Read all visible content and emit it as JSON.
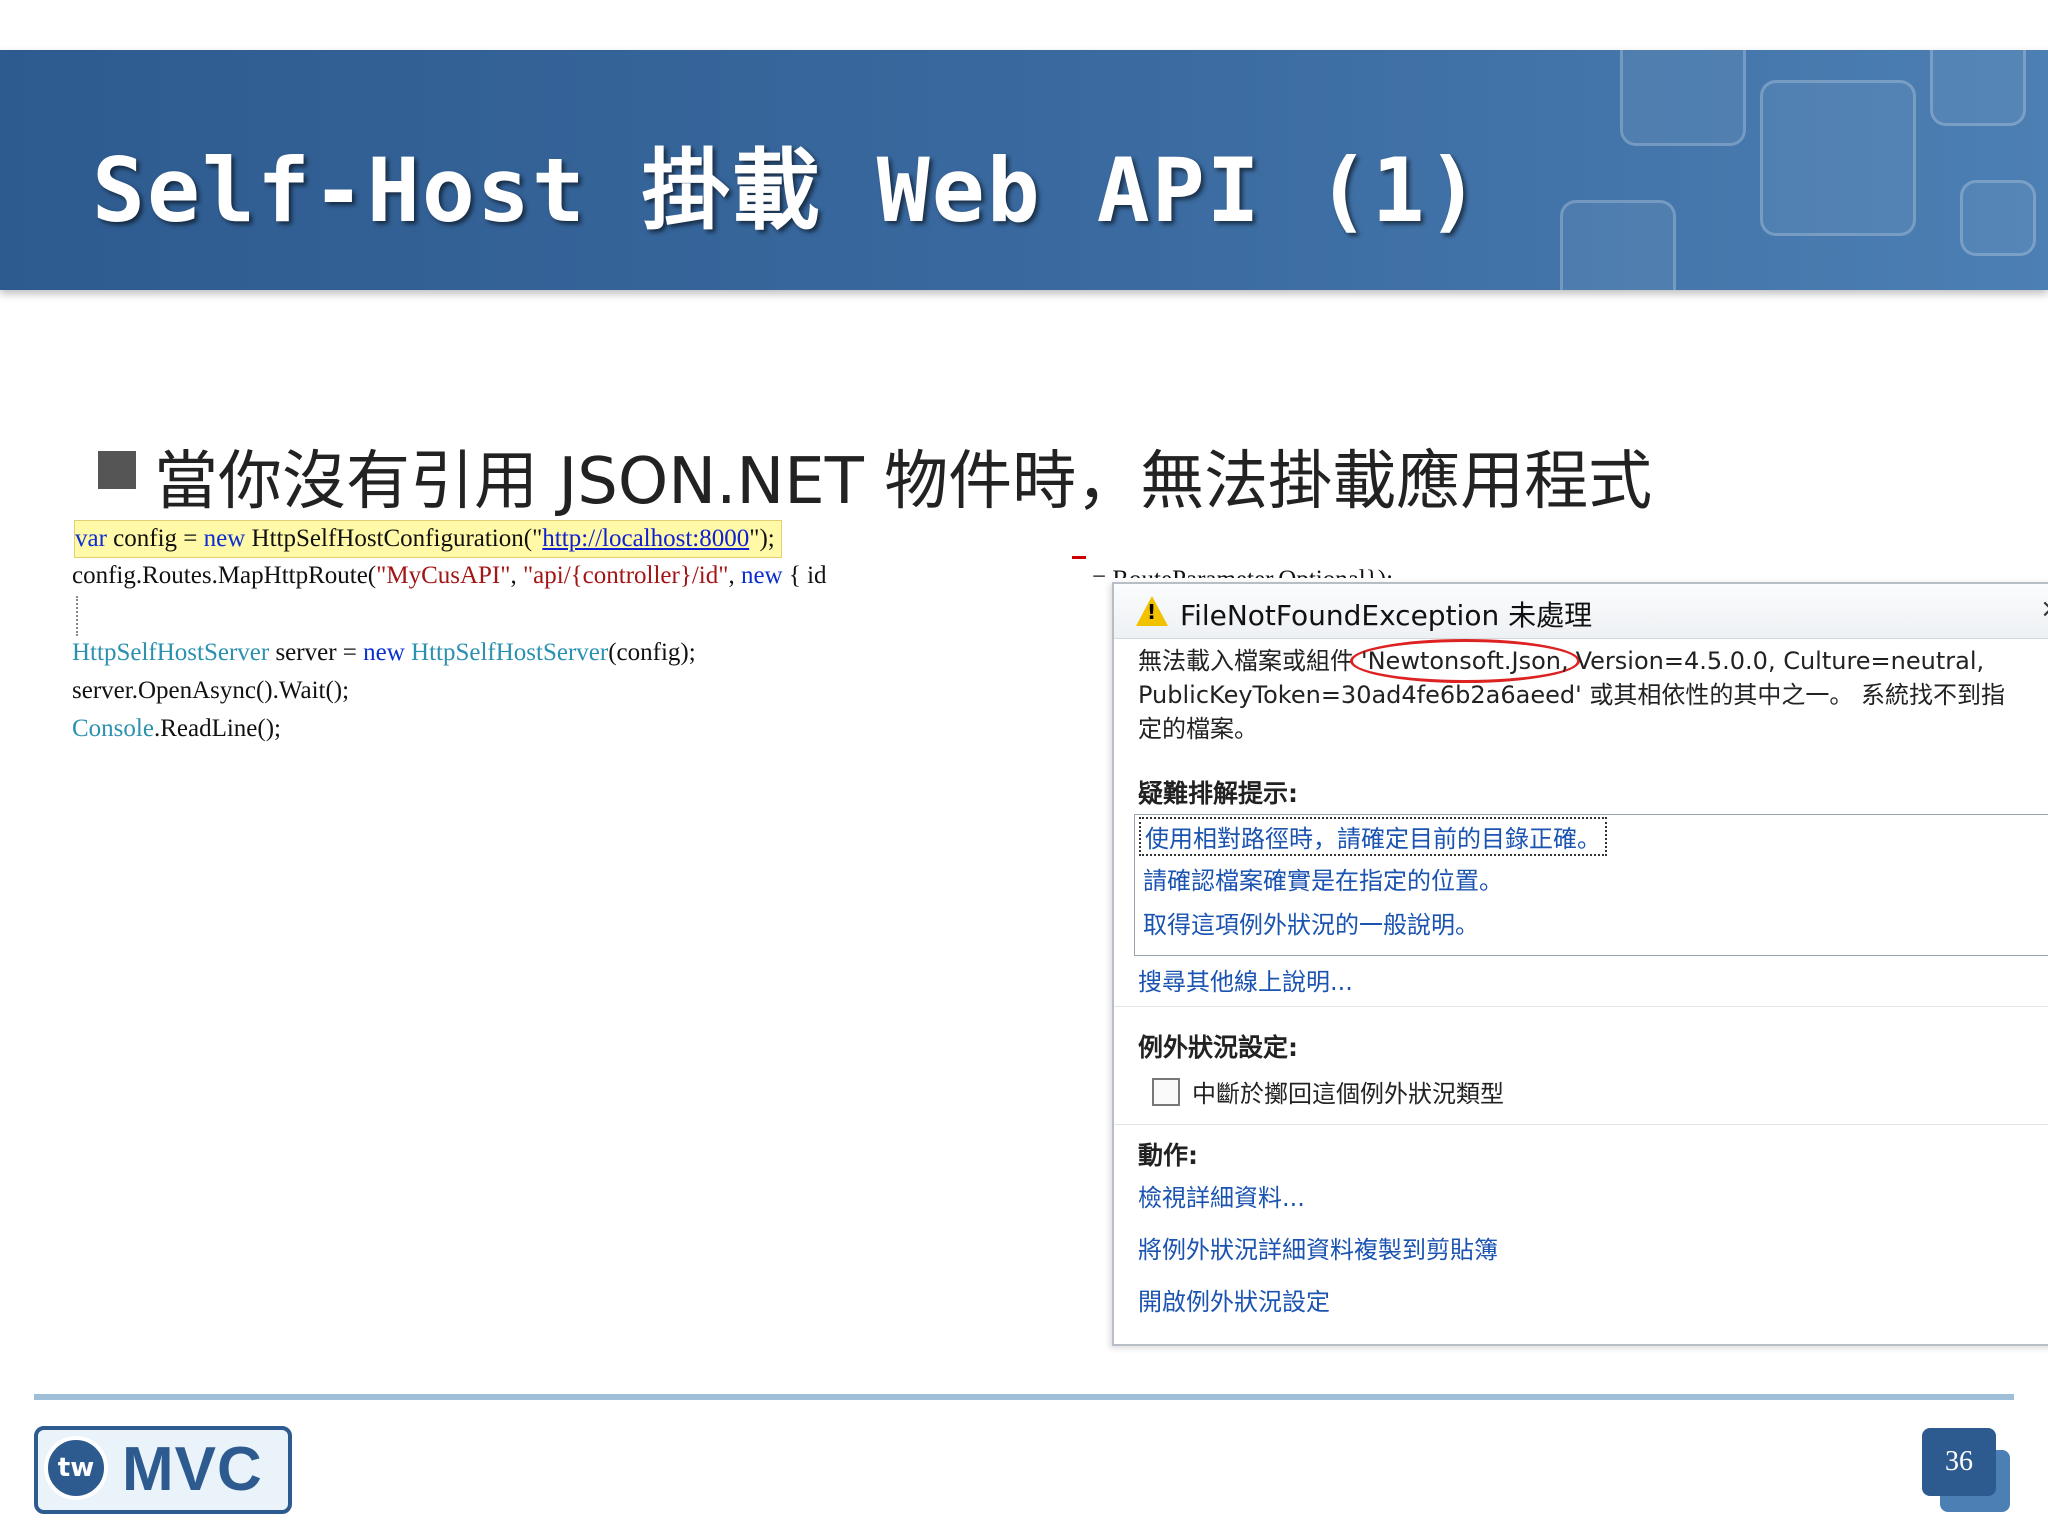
{
  "slide": {
    "title": "Self-Host 掛載 Web API (1)",
    "bullet": "當你沒有引用 JSON.NET 物件時，無法掛載應用程式",
    "page_number": "36"
  },
  "code": {
    "line1": {
      "kw_var": "var",
      "mid": " config = ",
      "kw_new": "new",
      "ctor": " HttpSelfHostConfiguration(\"",
      "url": "http://localhost:8000",
      "end": "\");"
    },
    "line2": {
      "pre": "config.Routes.MapHttpRoute(",
      "s1": "\"MyCusAPI\"",
      "comma": ", ",
      "s2": "\"api/{controller}/id\"",
      "comma2": ", ",
      "kw_new": "new",
      "end": " { id"
    },
    "line2_hidden": "= RouteParameter.Optional});",
    "line3": {
      "type": "HttpSelfHostServer",
      "mid": " server = ",
      "kw_new": "new",
      "type2": " HttpSelfHostServer",
      "end": "(config);"
    },
    "line4": "server.OpenAsync().Wait();",
    "line5": {
      "type": "Console",
      "end": ".ReadLine();"
    }
  },
  "dialog": {
    "title": "FileNotFoundException 未處理",
    "close_label": "×",
    "message": {
      "part1": "無法載入檔案或組件",
      "circled": "'Newtonsoft.Json,",
      "part2": "Version=4.5.0.0, Culture=neutral,",
      "line2": "PublicKeyToken=30ad4fe6b2a6aeed' 或其相依性的其中之一。 系統找不到指",
      "line3": "定的檔案。"
    },
    "troubleshooting_label": "疑難排解提示:",
    "tips": [
      "使用相對路徑時，請確定目前的目錄正確。",
      "請確認檔案確實是在指定的位置。",
      "取得這項例外狀況的一般說明。"
    ],
    "search_link": "搜尋其他線上說明...",
    "settings_label": "例外狀況設定:",
    "checkbox_label": "中斷於擲回這個例外狀況類型",
    "checkbox_checked": false,
    "actions_label": "動作:",
    "actions": [
      "檢視詳細資料...",
      "將例外狀況詳細資料複製到剪貼簿",
      "開啟例外狀況設定"
    ]
  },
  "footer": {
    "logo_badge": "tw",
    "logo_text": "MVC"
  },
  "colors": {
    "header_blue": "#2e5b8f",
    "link_blue": "#1a53b0",
    "highlight_yellow": "#fff9a8",
    "circle_red": "#dd2222"
  }
}
